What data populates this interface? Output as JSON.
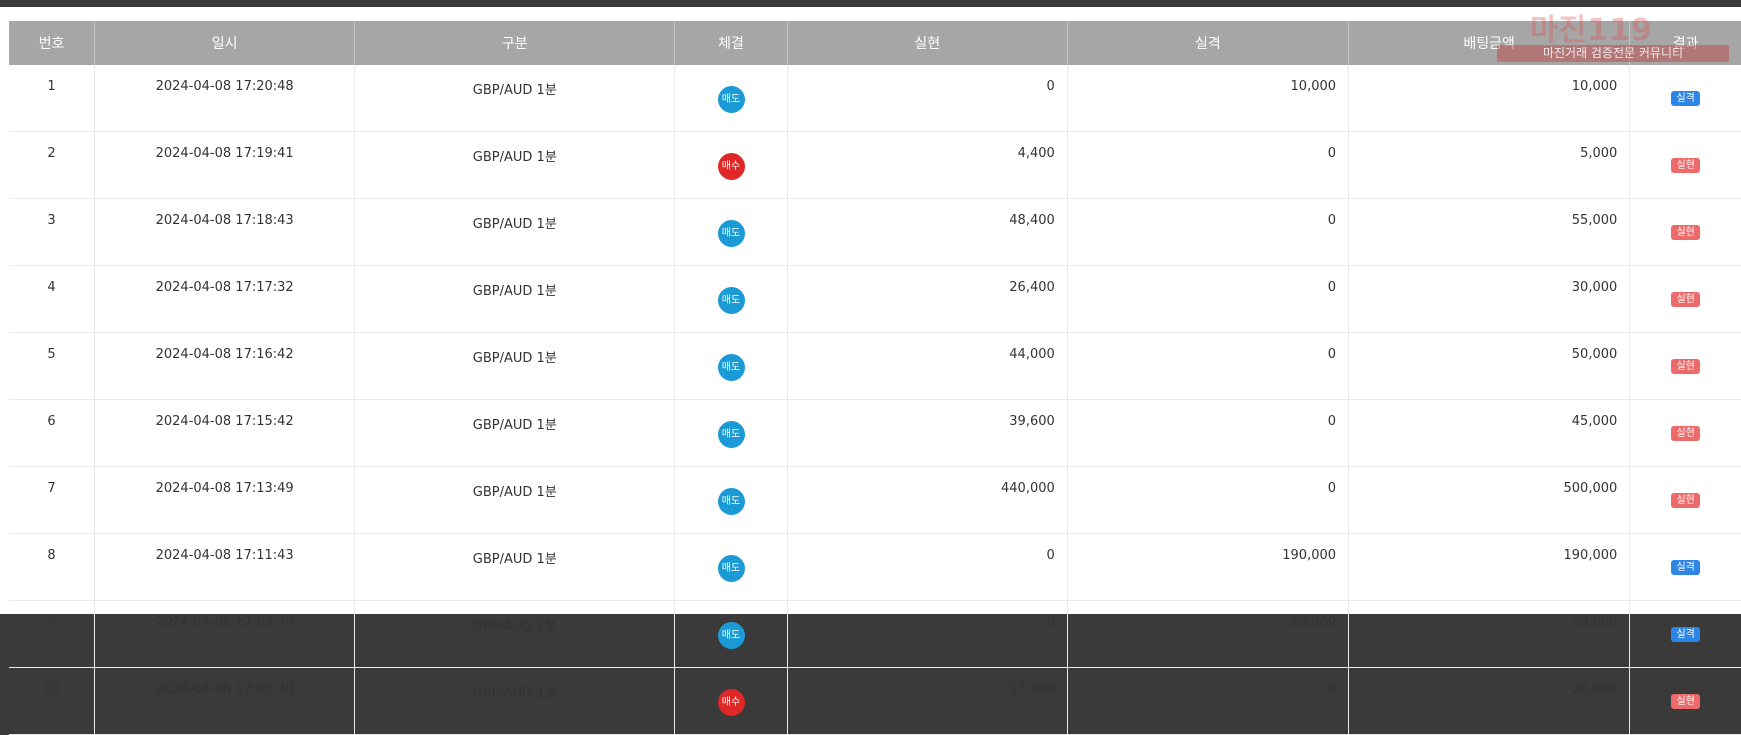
{
  "table": {
    "headers": [
      "번호",
      "일시",
      "구분",
      "체결",
      "실현",
      "실격",
      "배팅금액",
      "결과"
    ],
    "rows": [
      {
        "no": "1",
        "time": "2024-04-08 17:20:48",
        "type": "GBP/AUD 1분",
        "side": "매도",
        "side_kind": "sell",
        "realized": "0",
        "lost": "10,000",
        "bet": "10,000",
        "result": "실격",
        "result_kind": "loss"
      },
      {
        "no": "2",
        "time": "2024-04-08 17:19:41",
        "type": "GBP/AUD 1분",
        "side": "매수",
        "side_kind": "buy",
        "realized": "4,400",
        "lost": "0",
        "bet": "5,000",
        "result": "실현",
        "result_kind": "win"
      },
      {
        "no": "3",
        "time": "2024-04-08 17:18:43",
        "type": "GBP/AUD 1분",
        "side": "매도",
        "side_kind": "sell",
        "realized": "48,400",
        "lost": "0",
        "bet": "55,000",
        "result": "실현",
        "result_kind": "win"
      },
      {
        "no": "4",
        "time": "2024-04-08 17:17:32",
        "type": "GBP/AUD 1분",
        "side": "매도",
        "side_kind": "sell",
        "realized": "26,400",
        "lost": "0",
        "bet": "30,000",
        "result": "실현",
        "result_kind": "win"
      },
      {
        "no": "5",
        "time": "2024-04-08 17:16:42",
        "type": "GBP/AUD 1분",
        "side": "매도",
        "side_kind": "sell",
        "realized": "44,000",
        "lost": "0",
        "bet": "50,000",
        "result": "실현",
        "result_kind": "win"
      },
      {
        "no": "6",
        "time": "2024-04-08 17:15:42",
        "type": "GBP/AUD 1분",
        "side": "매도",
        "side_kind": "sell",
        "realized": "39,600",
        "lost": "0",
        "bet": "45,000",
        "result": "실현",
        "result_kind": "win"
      },
      {
        "no": "7",
        "time": "2024-04-08 17:13:49",
        "type": "GBP/AUD 1분",
        "side": "매도",
        "side_kind": "sell",
        "realized": "440,000",
        "lost": "0",
        "bet": "500,000",
        "result": "실현",
        "result_kind": "win"
      },
      {
        "no": "8",
        "time": "2024-04-08 17:11:43",
        "type": "GBP/AUD 1분",
        "side": "매도",
        "side_kind": "sell",
        "realized": "0",
        "lost": "190,000",
        "bet": "190,000",
        "result": "실격",
        "result_kind": "loss"
      },
      {
        "no": "9",
        "time": "2024-04-08 17:09:40",
        "type": "GBP/AUD 1분",
        "side": "매도",
        "side_kind": "sell",
        "realized": "0",
        "lost": "20,000",
        "bet": "20,000",
        "result": "실격",
        "result_kind": "loss"
      },
      {
        "no": "10",
        "time": "2024-04-08 17:08:40",
        "type": "GBP/AUD 1분",
        "side": "매수",
        "side_kind": "buy",
        "realized": "17,600",
        "lost": "0",
        "bet": "20,000",
        "result": "실현",
        "result_kind": "win"
      }
    ]
  },
  "watermark": {
    "brand": "마진119",
    "tagline": "마진거래 검증전문 커뮤니티"
  },
  "colors": {
    "header_bg": "#a6a6a6",
    "sell": "#1c9ad6",
    "buy": "#e02727",
    "loss_badge": "#2d86e6",
    "win_badge": "#ec6a6a"
  }
}
